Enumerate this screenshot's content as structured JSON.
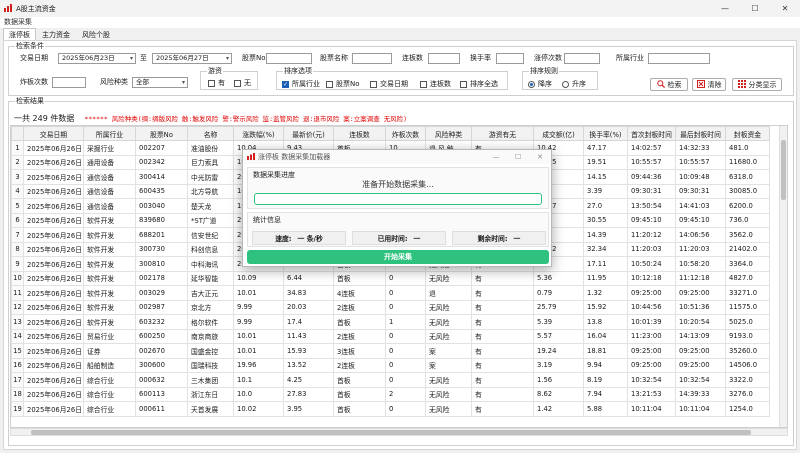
{
  "window": {
    "title": "A股主流资金",
    "controls": [
      "—",
      "☐",
      "✕"
    ]
  },
  "menu": {
    "label": "数据采集"
  },
  "tabs": [
    {
      "label": "涨停板",
      "active": true
    },
    {
      "label": "主力资金",
      "active": false
    },
    {
      "label": "风险个股",
      "active": false
    }
  ],
  "filters": {
    "legend": "检索条件",
    "trade_date_label": "交易日期",
    "date_from": "2025年06月23日",
    "to_label": "至",
    "date_to": "2025年06月27日",
    "stock_no_label": "股票No",
    "stock_no_value": "",
    "stock_name_label": "股票名称",
    "stock_name_value": "",
    "lianban_label": "连板数",
    "lianban_value": "",
    "turnover_label": "换手率",
    "turnover_value": "",
    "zhangting_label": "涨停次数",
    "zhangting_value": "",
    "industry_label": "所属行业",
    "industry_value": "",
    "zhaban_label": "炸板次数",
    "zhaban_value": "",
    "risk_label": "风险种类",
    "risk_value": "全部",
    "youzi": {
      "legend": "游资",
      "options": [
        {
          "label": "有",
          "checked": false
        },
        {
          "label": "无",
          "checked": false
        }
      ]
    },
    "sort_options": {
      "legend": "排序选项",
      "items": [
        {
          "label": "所属行业",
          "checked": true
        },
        {
          "label": "股票No",
          "checked": false
        },
        {
          "label": "交易日期",
          "checked": false
        },
        {
          "label": "连板数",
          "checked": false
        },
        {
          "label": "排序全选",
          "checked": false
        }
      ]
    },
    "sort_rule": {
      "legend": "排序规则",
      "options": [
        {
          "label": "降序",
          "checked": true
        },
        {
          "label": "升序",
          "checked": false
        }
      ]
    },
    "buttons": {
      "search": "检索",
      "clear": "清除",
      "category": "分类显示"
    }
  },
  "results": {
    "legend": "检索结果",
    "count_text": "一共 249 件数据",
    "risk_legend": "****** 风险种类(绸:绸版风险 触:触发风险 警:警示风险 监:监管风险 退:退市风险 案:立案调查 无风险)",
    "columns": [
      "交易日期",
      "所属行业",
      "股票No",
      "名称",
      "涨跌幅(%)",
      "最新价(元)",
      "连板数",
      "炸板次数",
      "风险种类",
      "游资有无",
      "成交额(亿)",
      "换手率(%)",
      "首次封板时间",
      "最后封板时间",
      "封板资金"
    ],
    "rows": [
      [
        "1",
        "2025年06月26日",
        "采掘行业",
        "002207",
        "准油股份",
        "10.04",
        "9.43",
        "首板",
        "10",
        "退,风,触",
        "有",
        "10.42",
        "47.17",
        "14:02:57",
        "14:32:33",
        "481.0"
      ],
      [
        "2",
        "2025年06月26日",
        "通用设备",
        "002342",
        "巨力索具",
        "10.05",
        "5.81",
        "首板",
        "0",
        "无风险",
        "有",
        "11.45",
        "19.51",
        "10:55:57",
        "10:55:57",
        "11680.0"
      ],
      [
        "3",
        "2025年06月26日",
        "通信设备",
        "300414",
        "中光防雷",
        "20.00",
        "13.92",
        "首板",
        "0",
        "无风险",
        "有",
        "4.68",
        "14.15",
        "09:44:36",
        "10:09:48",
        "6318.0"
      ],
      [
        "4",
        "2025年06月26日",
        "通信设备",
        "600435",
        "北方导航",
        "10.02",
        "14.27",
        "首板",
        "0",
        "无风险",
        "有",
        "7.3",
        "3.39",
        "09:30:31",
        "09:30:31",
        "30085.0"
      ],
      [
        "5",
        "2025年06月26日",
        "通信设备",
        "003040",
        "楚天龙",
        "10.01",
        "21.86",
        "首板",
        "0",
        "无风险",
        "有",
        "28.97",
        "27.0",
        "13:50:54",
        "14:41:03",
        "6200.0"
      ],
      [
        "6",
        "2025年06月26日",
        "软件开发",
        "839680",
        "*ST广道",
        "29.99",
        "7.98",
        "首板",
        "0",
        "警示",
        "有",
        "0.58",
        "30.55",
        "09:45:10",
        "09:45:10",
        "736.0"
      ],
      [
        "7",
        "2025年06月26日",
        "软件开发",
        "688201",
        "信安世纪",
        "20.00",
        "31.85",
        "首板",
        "0",
        "无风险",
        "有",
        "5.35",
        "14.39",
        "11:20:12",
        "14:06:56",
        "3562.0"
      ],
      [
        "8",
        "2025年06月26日",
        "软件开发",
        "300730",
        "科创信息",
        "20.01",
        "22.42",
        "首板",
        "0",
        "无风险",
        "有",
        "10.22",
        "32.34",
        "11:20:03",
        "11:20:03",
        "21402.0"
      ],
      [
        "9",
        "2025年06月26日",
        "软件开发",
        "300810",
        "中科海讯",
        "20.01",
        "44.32",
        "首板",
        "0",
        "无风险",
        "有",
        "8.16",
        "17.11",
        "10:50:24",
        "10:58:20",
        "3364.0"
      ],
      [
        "10",
        "2025年06月26日",
        "软件开发",
        "002178",
        "延华智能",
        "10.09",
        "6.44",
        "首板",
        "0",
        "无风险",
        "有",
        "5.36",
        "11.95",
        "10:12:18",
        "11:12:18",
        "4827.0"
      ],
      [
        "11",
        "2025年06月26日",
        "软件开发",
        "003029",
        "吉大正元",
        "10.01",
        "34.83",
        "4连板",
        "0",
        "退",
        "有",
        "0.79",
        "1.32",
        "09:25:00",
        "09:25:00",
        "33271.0"
      ],
      [
        "12",
        "2025年06月26日",
        "软件开发",
        "002987",
        "京北方",
        "9.99",
        "20.03",
        "2连板",
        "0",
        "无风险",
        "有",
        "25.79",
        "15.92",
        "10:44:56",
        "10:51:36",
        "11575.0"
      ],
      [
        "13",
        "2025年06月26日",
        "软件开发",
        "603232",
        "格尔软件",
        "9.99",
        "17.4",
        "首板",
        "1",
        "无风险",
        "有",
        "5.39",
        "13.8",
        "10:01:39",
        "10:20:54",
        "5025.0"
      ],
      [
        "14",
        "2025年06月26日",
        "贸易行业",
        "600250",
        "南京商旅",
        "10.01",
        "11.43",
        "2连板",
        "0",
        "无风险",
        "有",
        "5.57",
        "16.04",
        "11:23:00",
        "14:13:09",
        "9193.0"
      ],
      [
        "15",
        "2025年06月26日",
        "证券",
        "002670",
        "国盛金控",
        "10.01",
        "15.93",
        "3连板",
        "0",
        "案",
        "有",
        "19.24",
        "18.81",
        "09:25:00",
        "09:25:00",
        "35260.0"
      ],
      [
        "16",
        "2025年06月26日",
        "船舶制造",
        "300600",
        "国瑞科技",
        "19.96",
        "13.52",
        "2连板",
        "0",
        "案",
        "有",
        "3.19",
        "9.94",
        "09:25:00",
        "09:25:00",
        "14506.0"
      ],
      [
        "17",
        "2025年06月26日",
        "综合行业",
        "000632",
        "三木集团",
        "10.1",
        "4.25",
        "首板",
        "0",
        "无风险",
        "有",
        "1.56",
        "8.19",
        "10:32:54",
        "10:32:54",
        "3322.0"
      ],
      [
        "18",
        "2025年06月26日",
        "综合行业",
        "600113",
        "浙江东日",
        "10.0",
        "27.83",
        "首板",
        "2",
        "无风险",
        "有",
        "8.62",
        "7.94",
        "13:21:53",
        "14:39:33",
        "3276.0"
      ],
      [
        "19",
        "2025年06月26日",
        "综合行业",
        "000611",
        "天首发展",
        "10.02",
        "3.95",
        "首板",
        "0",
        "无风险",
        "有",
        "1.42",
        "5.88",
        "10:11:04",
        "10:11:04",
        "1254.0"
      ]
    ]
  },
  "dialog": {
    "title": "涨停板 数据采集加载器",
    "controls": [
      "—",
      "☐",
      "✕"
    ],
    "progress_section": "数据采集进度",
    "status_text": "准备开始数据采集...",
    "progress_percent": 0,
    "stats_section": "统计信息",
    "speed_label": "速度:",
    "speed_value": "一 条/秒",
    "elapsed_label": "已用时间:",
    "elapsed_value": "一",
    "remaining_label": "剩余时间:",
    "remaining_value": "一",
    "start_button": "开始采集"
  },
  "colors": {
    "accent_green": "#2ec27e",
    "risk_red": "#e00000",
    "icon_red": "#d02020",
    "checked_blue": "#1a5fb4"
  }
}
